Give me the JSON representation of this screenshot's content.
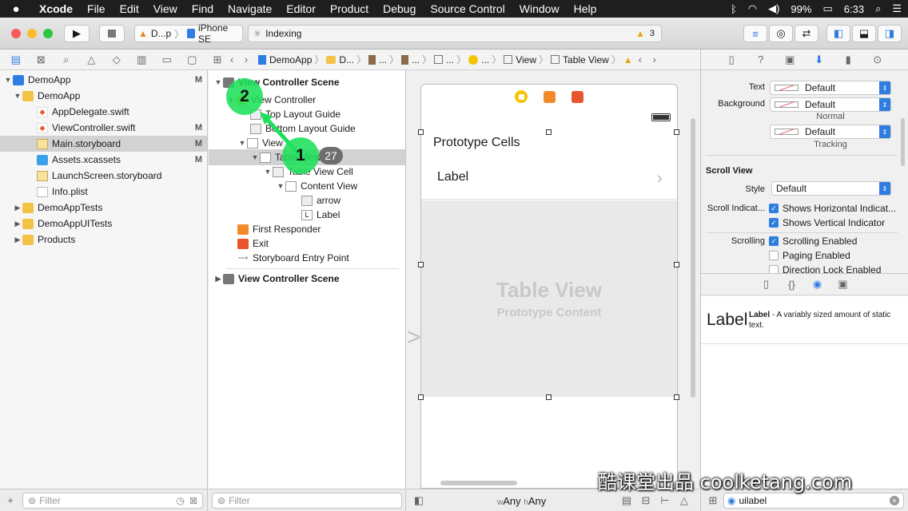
{
  "menubar": {
    "apple": "",
    "items": [
      "Xcode",
      "File",
      "Edit",
      "View",
      "Find",
      "Navigate",
      "Editor",
      "Product",
      "Debug",
      "Source Control",
      "Window",
      "Help"
    ],
    "battery": "99%",
    "time": "6:33"
  },
  "toolbar": {
    "scheme": "D...p",
    "device": "iPhone SE",
    "activity": "Indexing",
    "warnings": "3"
  },
  "navigator": {
    "items": [
      {
        "label": "DemoApp",
        "badge": "M"
      },
      {
        "label": "DemoApp",
        "badge": ""
      },
      {
        "label": "AppDelegate.swift",
        "badge": ""
      },
      {
        "label": "ViewController.swift",
        "badge": "M"
      },
      {
        "label": "Main.storyboard",
        "badge": "M"
      },
      {
        "label": "Assets.xcassets",
        "badge": "M"
      },
      {
        "label": "LaunchScreen.storyboard",
        "badge": ""
      },
      {
        "label": "Info.plist",
        "badge": ""
      },
      {
        "label": "DemoAppTests",
        "badge": ""
      },
      {
        "label": "DemoAppUITests",
        "badge": ""
      },
      {
        "label": "Products",
        "badge": ""
      }
    ],
    "filter_placeholder": "Filter"
  },
  "jumpbar": {
    "items": [
      "DemoApp",
      "D...",
      "...",
      "...",
      "...",
      "...",
      "View",
      "Table View"
    ]
  },
  "outline": {
    "items": [
      "View Controller Scene",
      "View Controller",
      "Top Layout Guide",
      "Bottom Layout Guide",
      "View",
      "Table View",
      "Table View Cell",
      "Content View",
      "arrow",
      "Label",
      "First Responder",
      "Exit",
      "Storyboard Entry Point",
      "View Controller Scene"
    ],
    "filter_placeholder": "Filter",
    "step1": "1",
    "step2": "2",
    "count": "27"
  },
  "canvas": {
    "prototype_cells": "Prototype Cells",
    "cell_label": "Label",
    "table_view": "Table View",
    "prototype_content": "Prototype Content",
    "size_w": "Any",
    "size_h": "Any",
    "w_prefix": "w",
    "h_prefix": "h"
  },
  "inspector": {
    "text_label": "Text",
    "text_value": "Default",
    "background_label": "Background",
    "background_value": "Default",
    "third_value": "Default",
    "normal": "Normal",
    "tracking": "Tracking",
    "section_scroll": "Scroll View",
    "style_label": "Style",
    "style_value": "Default",
    "indicators_label": "Scroll Indicat...",
    "shows_horizontal": "Shows Horizontal Indicat...",
    "shows_vertical": "Shows Vertical Indicator",
    "scrolling_label": "Scrolling",
    "scrolling_enabled": "Scrolling Enabled",
    "paging_enabled": "Paging Enabled",
    "direction_lock": "Direction Lock Enabled",
    "library_item_title": "Label",
    "library_item_name": "Label",
    "library_item_desc": "- A variably sized amount of static text.",
    "search_value": "uilabel"
  },
  "watermark": "酷课堂出品 coolketang.com",
  "colors": {
    "accent": "#2f7de0",
    "highlight": "#1ee05a"
  }
}
